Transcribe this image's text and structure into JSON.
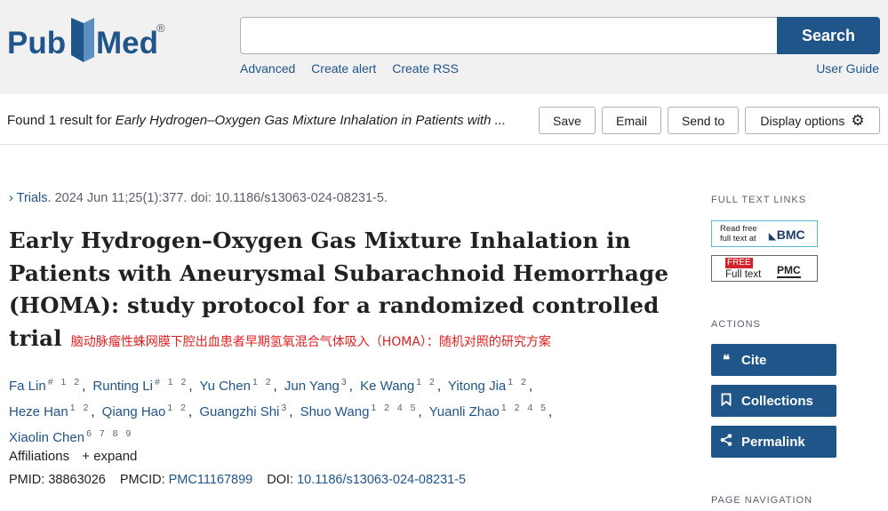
{
  "header": {
    "logo_text_left": "Pub",
    "logo_text_right": "Med",
    "logo_reg": "®",
    "search_placeholder": "",
    "search_button": "Search",
    "links": [
      "Advanced",
      "Create alert",
      "Create RSS"
    ],
    "user_guide": "User Guide"
  },
  "results_bar": {
    "found_prefix": "Found 1 result for ",
    "found_query": "Early Hydrogen–Oxygen Gas Mixture Inhalation in Patients with ...",
    "save": "Save",
    "email": "Email",
    "send_to": "Send to",
    "display_options": "Display options",
    "display_options_icon": "gear-icon"
  },
  "article": {
    "breadcrumb_chevron": "›",
    "journal": "Trials.",
    "citation": " 2024 Jun 11;25(1):377. doi: 10.1186/s13063-024-08231-5.",
    "title_lines": [
      "Early Hydrogen–Oxygen Gas Mixture Inhalation in",
      "Patients with Aneurysmal Subarachnoid Hemorrhage",
      "(HOMA): study protocol for a randomized controlled",
      "trial"
    ],
    "translation": "脑动脉瘤性蛛网膜下腔出血患者早期氢氧混合气体吸入（HOMA）：随机对照的研究方案",
    "authors": [
      {
        "name": "Fa Lin",
        "sup": "# 1 2"
      },
      {
        "name": "Runting Li",
        "sup": "# 1 2"
      },
      {
        "name": "Yu Chen",
        "sup": "1 2"
      },
      {
        "name": "Jun Yang",
        "sup": "3"
      },
      {
        "name": "Ke Wang",
        "sup": "1 2"
      },
      {
        "name": "Yitong Jia",
        "sup": "1 2"
      },
      {
        "name": "Heze Han",
        "sup": "1 2"
      },
      {
        "name": "Qiang Hao",
        "sup": "1 2"
      },
      {
        "name": "Guangzhi Shi",
        "sup": "3"
      },
      {
        "name": "Shuo Wang",
        "sup": "1 2 4 5"
      },
      {
        "name": "Yuanli Zhao",
        "sup": "1 2 4 5"
      },
      {
        "name": "Xiaolin Chen",
        "sup": "6 7 8 9"
      }
    ],
    "affiliations": "Affiliations",
    "expand": "+ expand",
    "pmid_label": "PMID: ",
    "pmid": "38863026",
    "pmcid_label": "PMCID: ",
    "pmcid": "PMC11167899",
    "doi_label": "DOI: ",
    "doi": "10.1186/s13063-024-08231-5"
  },
  "sidebar": {
    "full_text_links": "FULL TEXT LINKS",
    "bmc_read": "Read free",
    "bmc_full": "full text at",
    "bmc_logo": "BMC",
    "pmc_free": "FREE",
    "pmc_full": "Full text",
    "pmc_logo": "PMC",
    "actions": "ACTIONS",
    "cite": "Cite",
    "collections": "Collections",
    "permalink": "Permalink",
    "page_navigation": "PAGE NAVIGATION"
  },
  "colors": {
    "brand_blue": "#20558a",
    "translation_red": "#e02020",
    "header_bg": "#f1f1f1"
  }
}
